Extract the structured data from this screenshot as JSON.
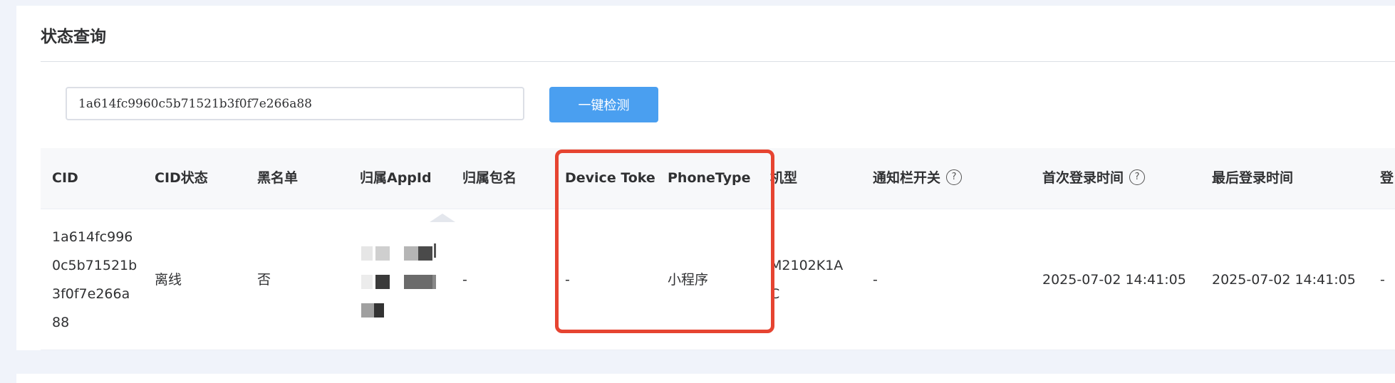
{
  "section": {
    "title": "状态查询"
  },
  "search": {
    "value": "1a614fc9960c5b71521b3f0f7e266a88",
    "button_label": "一键检测"
  },
  "table": {
    "columns": [
      {
        "key": "cid",
        "label": "CID"
      },
      {
        "key": "cid_status",
        "label": "CID状态"
      },
      {
        "key": "blacklist",
        "label": "黑名单"
      },
      {
        "key": "appid",
        "label": "归属AppId"
      },
      {
        "key": "package",
        "label": "归属包名"
      },
      {
        "key": "device_token",
        "label": "Device Token"
      },
      {
        "key": "phone_type",
        "label": "PhoneType"
      },
      {
        "key": "model",
        "label": "机型"
      },
      {
        "key": "notify_switch",
        "label": "通知栏开关",
        "help_icon": "question-circle-icon"
      },
      {
        "key": "first_login",
        "label": "首次登录时间",
        "help_icon": "question-circle-icon"
      },
      {
        "key": "last_login",
        "label": "最后登录时间"
      },
      {
        "key": "last_col",
        "label": "登"
      }
    ],
    "rows": [
      {
        "cid": "1a614fc9960c5b71521b3f0f7e266a88",
        "cid_status": "离线",
        "blacklist": "否",
        "appid": "",
        "package": "-",
        "device_token": "-",
        "phone_type": "小程序",
        "model": "M2102K1AC",
        "notify_switch": "-",
        "first_login": "2025-07-02 14:41:05",
        "last_login": "2025-07-02 14:41:05",
        "last_col": "-"
      }
    ]
  },
  "colors": {
    "button": "#4a9ff0",
    "highlight": "#e64431",
    "header_bg": "#f7f8fa",
    "page_bg": "#f0f3fa"
  }
}
